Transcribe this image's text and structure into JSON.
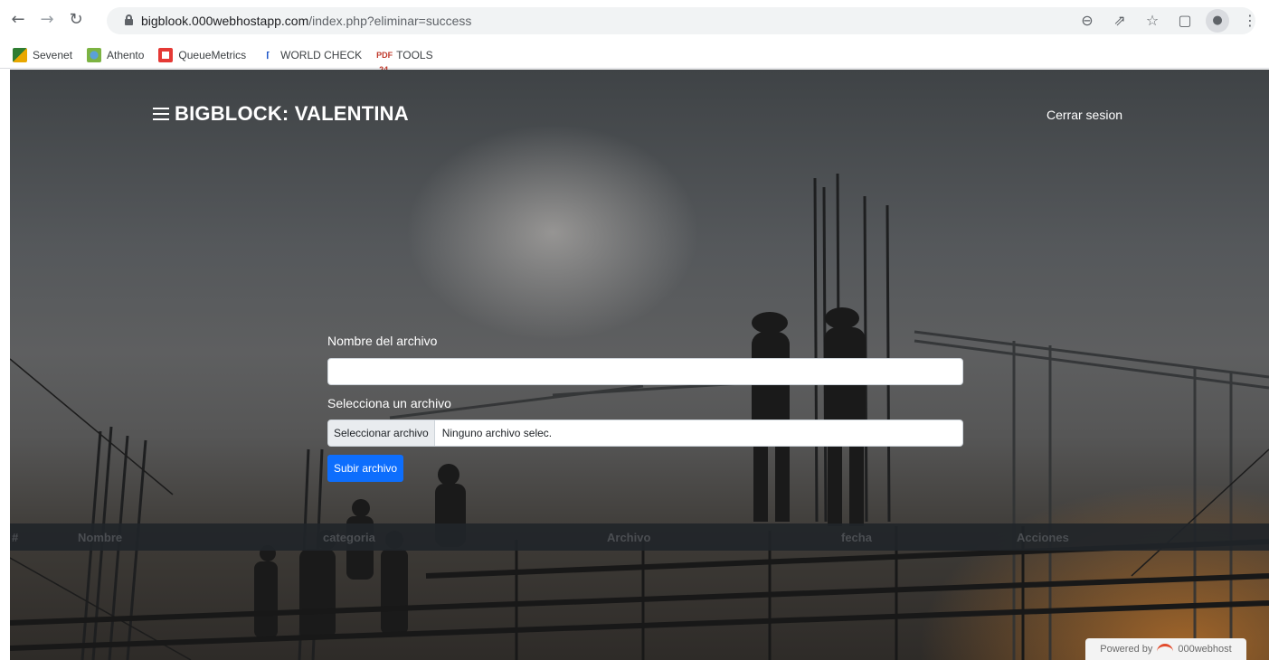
{
  "browser": {
    "url_domain": "bigblook.000webhostapp.com",
    "url_path": "/index.php?eliminar=success",
    "bookmarks": [
      {
        "label": "Sevenet",
        "icon": "sevenet-icon"
      },
      {
        "label": "Athento",
        "icon": "athento-icon"
      },
      {
        "label": "QueueMetrics",
        "icon": "queuemetrics-icon"
      },
      {
        "label": "WORLD CHECK",
        "icon": "world-check-icon"
      },
      {
        "label": "TOOLS",
        "icon": "pdf24-icon"
      }
    ]
  },
  "navbar": {
    "brand": "BIGBLOCK: VALENTINA",
    "logout": "Cerrar sesion"
  },
  "form": {
    "name_label": "Nombre del archivo",
    "name_value": "",
    "file_label": "Selecciona un archivo",
    "file_button": "Seleccionar archivo",
    "file_status": "Ninguno archivo selec.",
    "submit": "Subir archivo"
  },
  "table": {
    "headers": [
      "#",
      "Nombre",
      "categoria",
      "Archivo",
      "fecha",
      "Acciones"
    ]
  },
  "footer": {
    "powered_prefix": "Powered by",
    "powered_brand": "000webhost"
  },
  "colors": {
    "primary_button": "#0d6efd",
    "table_header_bg": "#212529",
    "powered_logo": "#e24b2c"
  }
}
